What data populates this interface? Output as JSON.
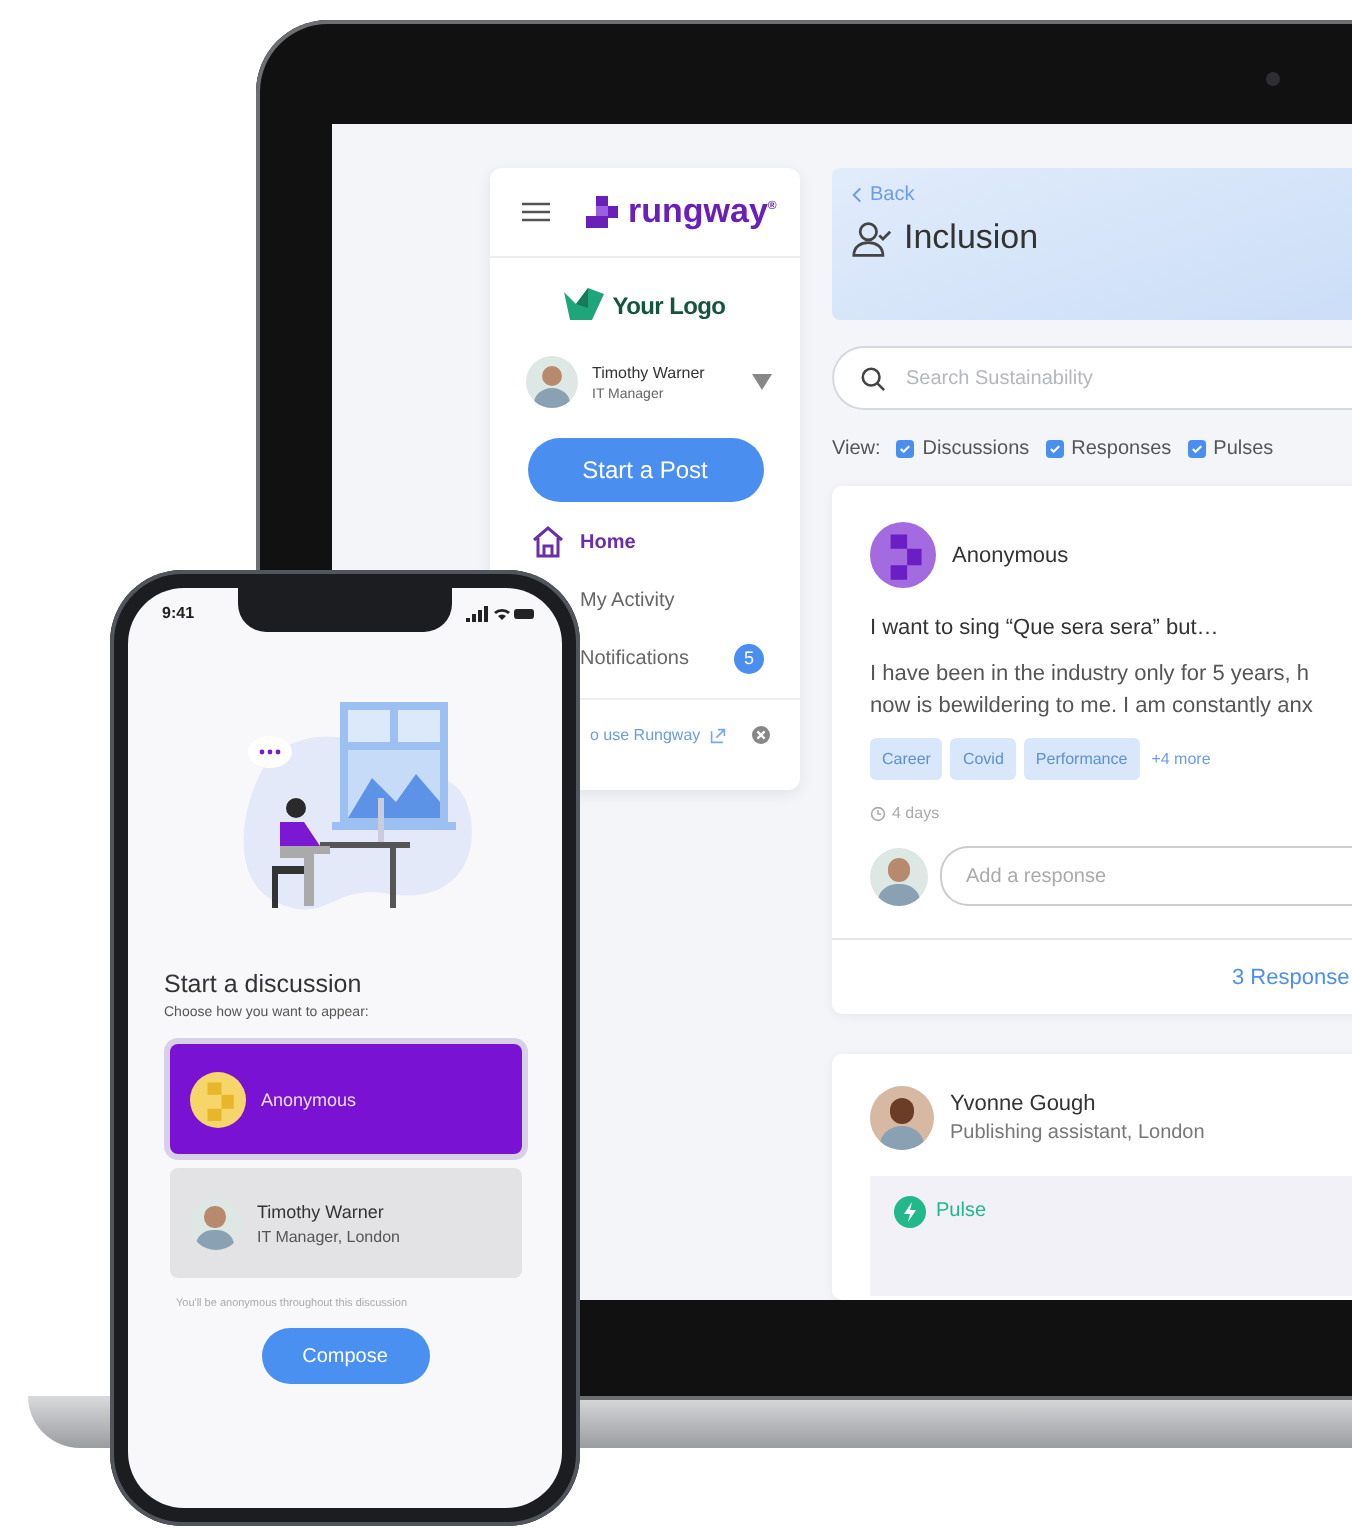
{
  "laptop": {
    "sidebar": {
      "brand": "rungway$^{®}$",
      "org_logo": "Your Logo",
      "user": {
        "name": "Timothy Warner",
        "role": "IT Manager"
      },
      "start_button": "Start a Post",
      "nav": [
        {
          "label": "Home",
          "selected": true
        },
        {
          "label": "My Activity",
          "selected": false
        },
        {
          "label": "Notifications",
          "selected": false,
          "count": "5"
        }
      ],
      "help_link": "o use Rungway"
    },
    "header": {
      "back": "Back",
      "title": "Inclusion"
    },
    "search": {
      "placeholder": "Search Sustainability"
    },
    "view": {
      "label": "View:",
      "filters": [
        {
          "label": "Discussions",
          "checked": true
        },
        {
          "label": "Responses",
          "checked": true
        },
        {
          "label": "Pulses",
          "checked": true
        }
      ]
    },
    "posts": [
      {
        "kind": "discussion",
        "author": "Anonymous",
        "title": "I want to sing “Que sera sera” but…",
        "body_lines": [
          "I have been in the industry only for 5 years, h",
          "now is bewildering to me. I am constantly anx"
        ],
        "tags": [
          "Career",
          "Covid",
          "Performance"
        ],
        "more_tags": "+4 more",
        "age": "4 days",
        "response_placeholder": "Add a response",
        "responses": "3 Response"
      },
      {
        "kind": "pulse",
        "author": "Yvonne Gough",
        "subtitle": "Publishing assistant, London",
        "badge": "Pulse"
      }
    ]
  },
  "phone": {
    "time": "9:41",
    "title": "Start a discussion",
    "prompt": "Choose how you want to appear:",
    "identities": [
      {
        "kind": "anonymous",
        "name": "Anonymous",
        "selected": true
      },
      {
        "kind": "person",
        "name": "Timothy Warner",
        "subtitle": "IT Manager, London",
        "selected": false
      }
    ],
    "note": "You'll be anonymous throughout this discussion",
    "compose": "Compose"
  }
}
